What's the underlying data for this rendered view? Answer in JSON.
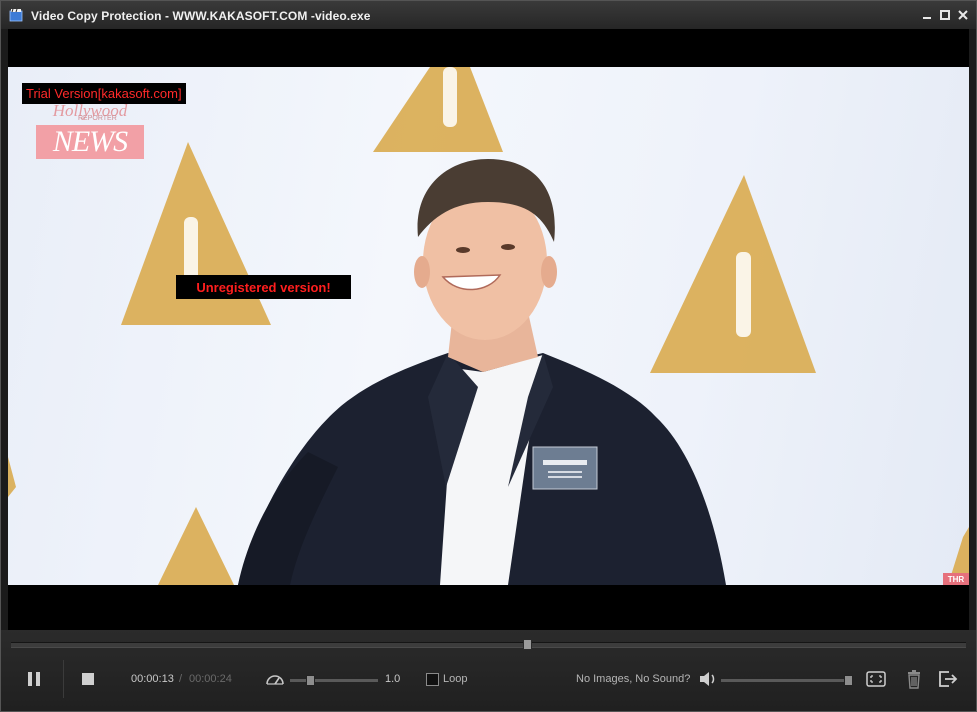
{
  "window": {
    "title": "Video Copy Protection - WWW.KAKASOFT.COM -video.exe",
    "icons": [
      "app-icon",
      "minimize-icon",
      "maximize-icon",
      "close-icon"
    ]
  },
  "video": {
    "trial_watermark": "Trial Version[kakasoft.com]",
    "unregistered_notice": "Unregistered version!",
    "logo_top": "Hollywood",
    "logo_sub": "REPORTER",
    "logo_main": "NEWS",
    "corner_logo": "THR"
  },
  "controls": {
    "current_time": "00:00:13",
    "separator": "/",
    "total_time": "00:00:24",
    "progress_fraction": 0.54,
    "speed_value": "1.0",
    "loop_label": "Loop",
    "loop_checked": false,
    "no_images_link": "No Images, No Sound?",
    "volume_fraction": 1.0,
    "icons": [
      "pause-icon",
      "stop-icon",
      "speedometer-icon",
      "volume-icon",
      "fullscreen-icon",
      "trash-icon",
      "exit-icon"
    ]
  },
  "colors": {
    "titlebar": "#2e2e2e",
    "watermark_text": "#ff2a2a",
    "controls_bg": "#262626"
  }
}
